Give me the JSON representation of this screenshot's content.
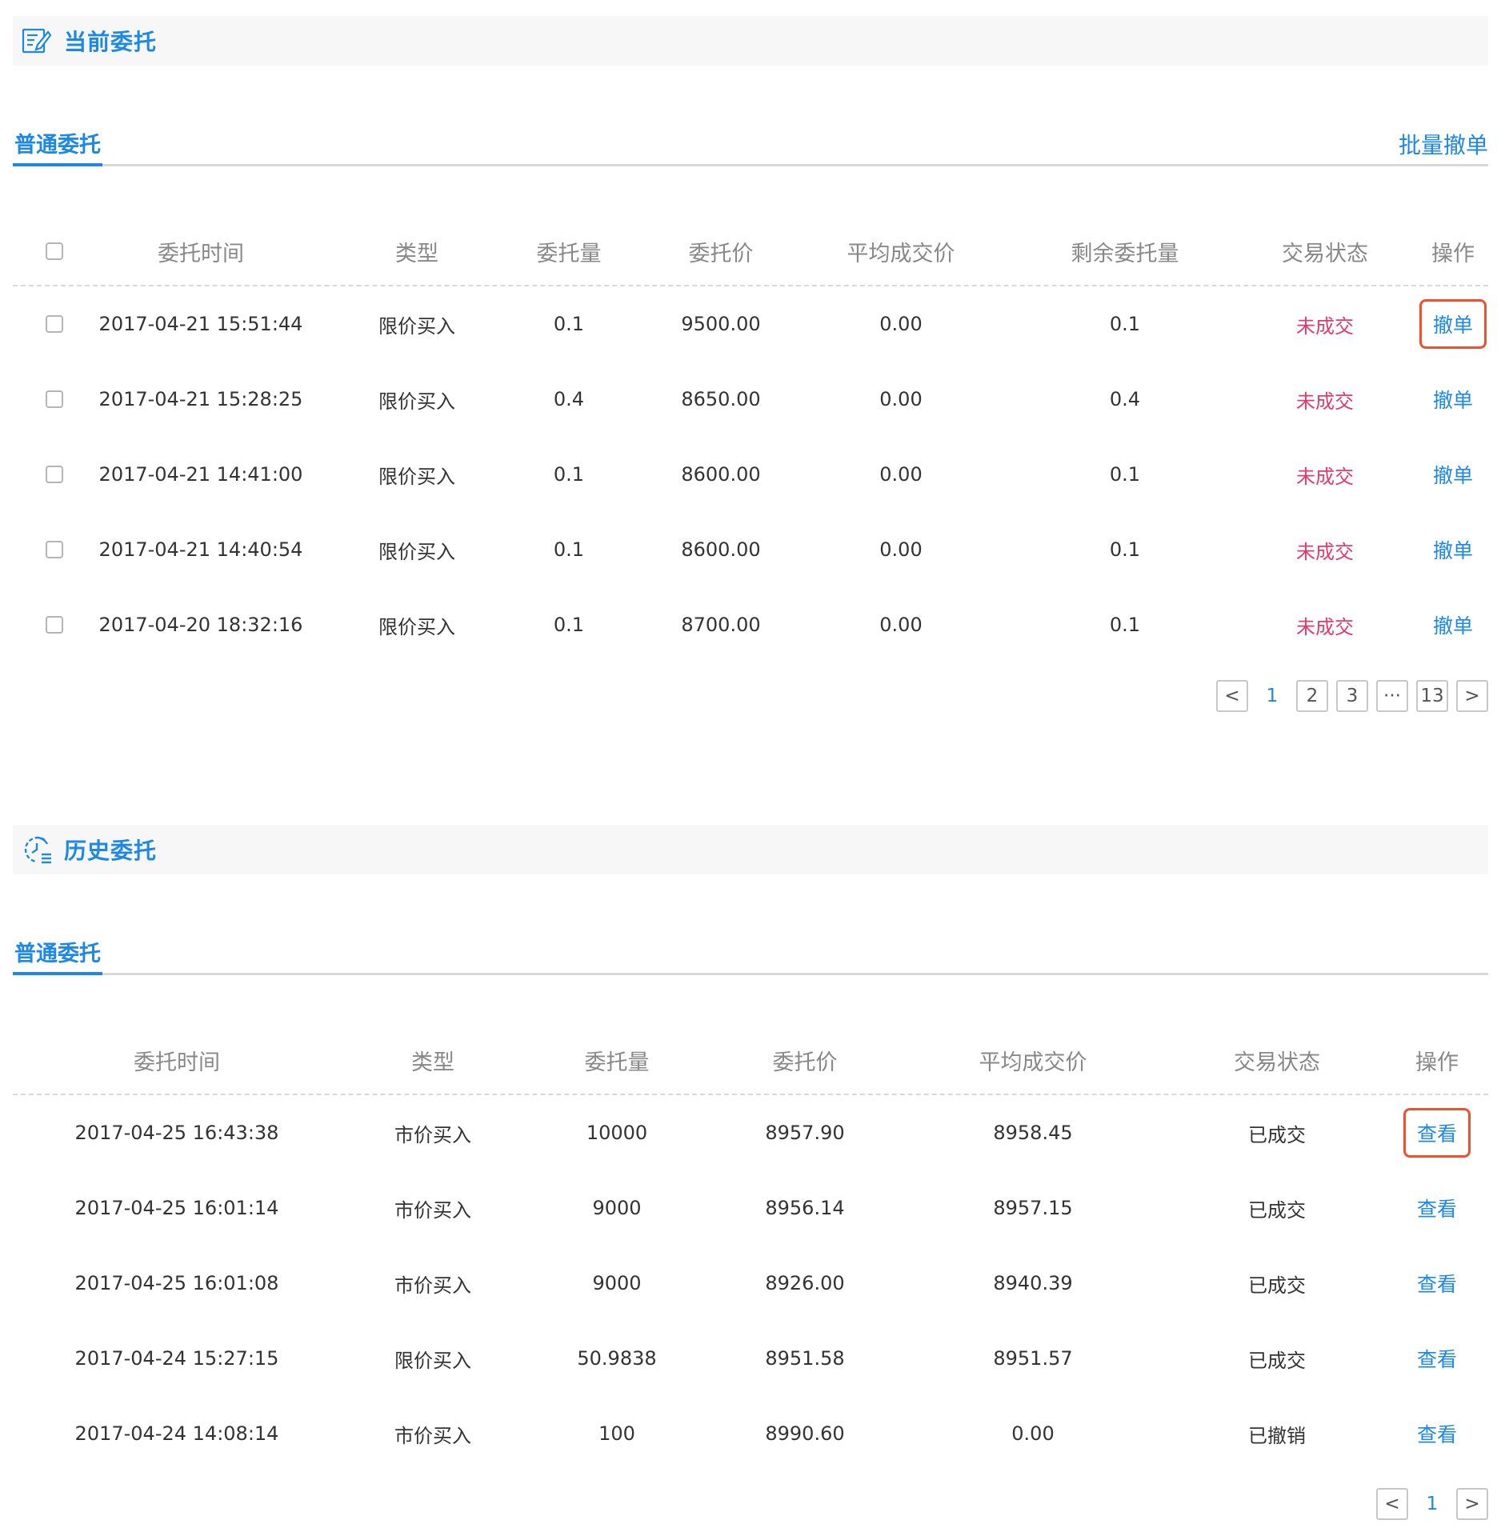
{
  "current": {
    "title": "当前委托",
    "tab": "普通委托",
    "batch_cancel": "批量撤单",
    "headers": [
      "委托时间",
      "类型",
      "委托量",
      "委托价",
      "平均成交价",
      "剩余委托量",
      "交易状态",
      "操作"
    ],
    "rows": [
      {
        "time": "2017-04-21 15:51:44",
        "type": "限价买入",
        "qty": "0.1",
        "price": "9500.00",
        "avg": "0.00",
        "remain": "0.1",
        "status": "未成交",
        "action": "撤单"
      },
      {
        "time": "2017-04-21 15:28:25",
        "type": "限价买入",
        "qty": "0.4",
        "price": "8650.00",
        "avg": "0.00",
        "remain": "0.4",
        "status": "未成交",
        "action": "撤单"
      },
      {
        "time": "2017-04-21 14:41:00",
        "type": "限价买入",
        "qty": "0.1",
        "price": "8600.00",
        "avg": "0.00",
        "remain": "0.1",
        "status": "未成交",
        "action": "撤单"
      },
      {
        "time": "2017-04-21 14:40:54",
        "type": "限价买入",
        "qty": "0.1",
        "price": "8600.00",
        "avg": "0.00",
        "remain": "0.1",
        "status": "未成交",
        "action": "撤单"
      },
      {
        "time": "2017-04-20 18:32:16",
        "type": "限价买入",
        "qty": "0.1",
        "price": "8700.00",
        "avg": "0.00",
        "remain": "0.1",
        "status": "未成交",
        "action": "撤单"
      }
    ],
    "pagination": {
      "prev": "<",
      "pages": [
        "1",
        "2",
        "3",
        "···",
        "13"
      ],
      "next": ">"
    }
  },
  "history": {
    "title": "历史委托",
    "tab": "普通委托",
    "headers": [
      "委托时间",
      "类型",
      "委托量",
      "委托价",
      "平均成交价",
      "交易状态",
      "操作"
    ],
    "rows": [
      {
        "time": "2017-04-25 16:43:38",
        "type": "市价买入",
        "qty": "10000",
        "price": "8957.90",
        "avg": "8958.45",
        "status": "已成交",
        "action": "查看"
      },
      {
        "time": "2017-04-25 16:01:14",
        "type": "市价买入",
        "qty": "9000",
        "price": "8956.14",
        "avg": "8957.15",
        "status": "已成交",
        "action": "查看"
      },
      {
        "time": "2017-04-25 16:01:08",
        "type": "市价买入",
        "qty": "9000",
        "price": "8926.00",
        "avg": "8940.39",
        "status": "已成交",
        "action": "查看"
      },
      {
        "time": "2017-04-24 15:27:15",
        "type": "限价买入",
        "qty": "50.9838",
        "price": "8951.58",
        "avg": "8951.57",
        "status": "已成交",
        "action": "查看"
      },
      {
        "time": "2017-04-24 14:08:14",
        "type": "市价买入",
        "qty": "100",
        "price": "8990.60",
        "avg": "0.00",
        "status": "已撤销",
        "action": "查看"
      }
    ],
    "pagination": {
      "prev": "<",
      "pages": [
        "1"
      ],
      "next": ">"
    }
  },
  "colors": {
    "accent": "#1e88e5",
    "status_open": "#e5396a",
    "highlight": "#f0502e"
  }
}
